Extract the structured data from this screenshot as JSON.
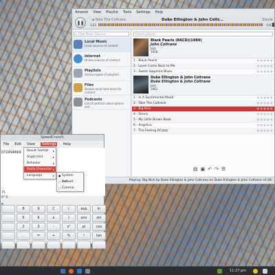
{
  "amarok": {
    "menu": [
      "Amarok",
      "View",
      "Playlist",
      "Tools",
      "Settings",
      "Help"
    ],
    "toolbar": {
      "previous_track": "◄ Take The Coltrane",
      "current_artist": "Duke Ellington & John Coltr...",
      "next_track": "Stevie",
      "time_elapsed": "3:22",
      "time_remaining": "-0:02"
    },
    "sources": {
      "filter_placeholder": "Filter Music Sources",
      "items": [
        {
          "title": "Local Music",
          "desc": "Local sources of content",
          "color": "#5b7fb5"
        },
        {
          "title": "Internet",
          "desc": "Online sources of content",
          "color": "#3d8fd1"
        },
        {
          "title": "Playlists",
          "desc": "Various types of playlists",
          "color": "#9aa5b8"
        },
        {
          "title": "Files",
          "desc": "Browse local hard drive for content",
          "color": "#d0a248"
        },
        {
          "title": "Podcasts",
          "desc": "List of podcast subscriptions and ...",
          "color": "#8b8f96"
        }
      ]
    },
    "playlist": {
      "search_placeholder": "Search playlist",
      "album1": {
        "title": "Black Pearls (RKCD)(1989)",
        "artist": "John Coltrane",
        "genre": "Jazz",
        "year": "1958"
      },
      "group1_tracks": [
        "1 - Black Pearls",
        "2 - Lover Come Back to Me",
        "3 - Sweet Sapphire Blues"
      ],
      "album2": {
        "title": "Duke Ellington & John Coltrane",
        "artist": "Duke Ellington & John Coltrane",
        "genre": "Jazz",
        "year": "1962"
      },
      "group2_tracks": [
        "1 - In A Sentimental Mood",
        "2 - Take The Coltrane",
        "3 - Big Nick",
        "4 - Stevie",
        "5 - My Little Brown Book",
        "6 - Angelica",
        "7 - The Feeling Of Jazz"
      ],
      "playing_index": 2
    },
    "status": "Playing: Big Nick by Duke Ellington & John Coltrane on Duke Ellington & John Coltrane (4:28)",
    "accent": "#c7392f"
  },
  "speedcrunch": {
    "title": "SpeedCrunch",
    "menu": [
      "File",
      "Edit",
      "View",
      "Settings",
      "Help"
    ],
    "results": [
      "072494669",
      "75",
      "0^2",
      "6"
    ],
    "settings_menu": [
      "Result Format",
      "Angle Unit",
      "Behavior",
      "Radix Character",
      "Language"
    ],
    "radix_options": [
      "System Default",
      "Dot",
      "Comma"
    ],
    "keys": [
      "",
      "8",
      "9",
      "C",
      "(",
      "exp",
      "ln",
      "",
      "5",
      "6",
      "x",
      ")",
      "ans",
      "sin",
      "",
      "2",
      "3",
      "-",
      "x²",
      "pi",
      "cos",
      "",
      ".",
      "=",
      "+",
      "%",
      "!",
      "tan",
      "",
      "",
      "",
      "",
      "",
      "",
      ""
    ]
  },
  "taskbar": {
    "clock": "11:27 pm"
  }
}
